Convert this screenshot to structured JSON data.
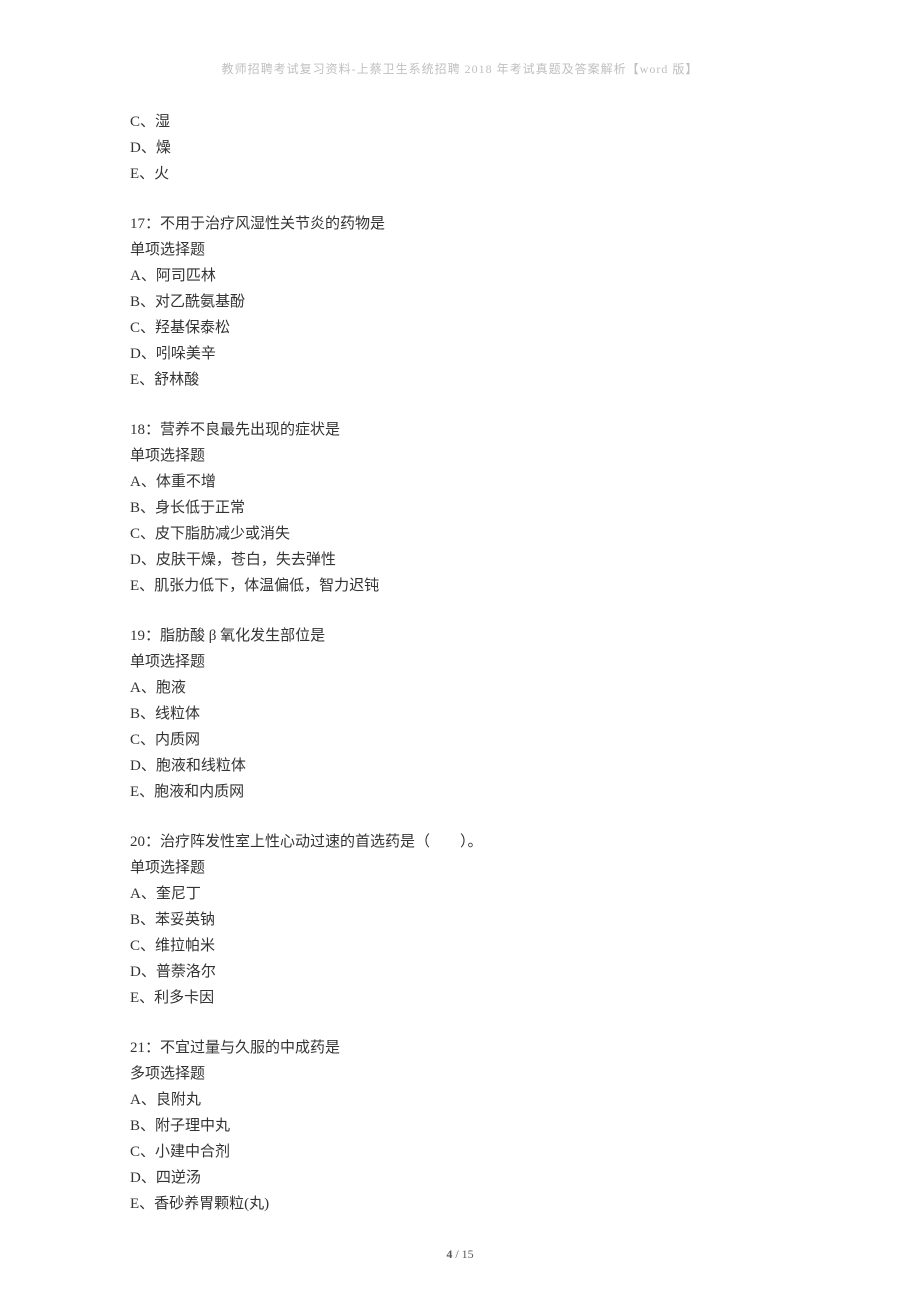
{
  "header": "教师招聘考试复习资料-上蔡卫生系统招聘 2018 年考试真题及答案解析【word 版】",
  "prev_options": [
    "C、湿",
    "D、燥",
    "E、火"
  ],
  "questions": [
    {
      "title": "17：不用于治疗风湿性关节炎的药物是",
      "type": "单项选择题",
      "options": [
        "A、阿司匹林",
        "B、对乙酰氨基酚",
        "C、羟基保泰松",
        "D、吲哚美辛",
        "E、舒林酸"
      ]
    },
    {
      "title": "18：营养不良最先出现的症状是",
      "type": "单项选择题",
      "options": [
        "A、体重不增",
        "B、身长低于正常",
        "C、皮下脂肪减少或消失",
        "D、皮肤干燥，苍白，失去弹性",
        "E、肌张力低下，体温偏低，智力迟钝"
      ]
    },
    {
      "title": "19：脂肪酸 β 氧化发生部位是",
      "type": "单项选择题",
      "options": [
        "A、胞液",
        "B、线粒体",
        "C、内质网",
        "D、胞液和线粒体",
        "E、胞液和内质网"
      ]
    },
    {
      "title": "20：治疗阵发性室上性心动过速的首选药是（　　）。",
      "type": "单项选择题",
      "options": [
        "A、奎尼丁",
        "B、苯妥英钠",
        "C、维拉帕米",
        "D、普萘洛尔",
        "E、利多卡因"
      ]
    },
    {
      "title": "21：不宜过量与久服的中成药是",
      "type": "多项选择题",
      "options": [
        "A、良附丸",
        "B、附子理中丸",
        "C、小建中合剂",
        "D、四逆汤",
        "E、香砂养胃颗粒(丸)"
      ]
    }
  ],
  "footer": {
    "current": "4",
    "sep": " / ",
    "total": "15"
  }
}
